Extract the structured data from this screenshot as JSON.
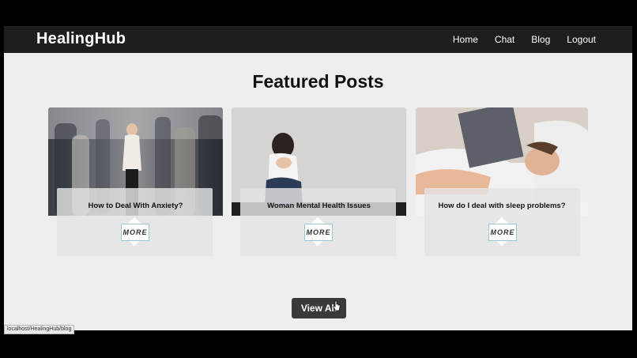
{
  "app": {
    "brand": "HealingHub",
    "nav": [
      "Home",
      "Chat",
      "Blog",
      "Logout"
    ]
  },
  "main": {
    "heading": "Featured Posts",
    "posts": [
      {
        "title": "How to Deal With Anxiety?",
        "button": "MORE"
      },
      {
        "title": "Woman Mental Health Issues",
        "button": "MORE"
      },
      {
        "title": "How do I deal with sleep problems?",
        "button": "MORE"
      }
    ],
    "view_all": "View All"
  },
  "status_bar": {
    "url": "localhost/HealingHub/blog"
  },
  "colors": {
    "nav_bg": "#1e1e1e",
    "page_bg": "#eeeeee",
    "button_bg": "#3a3a3a"
  }
}
